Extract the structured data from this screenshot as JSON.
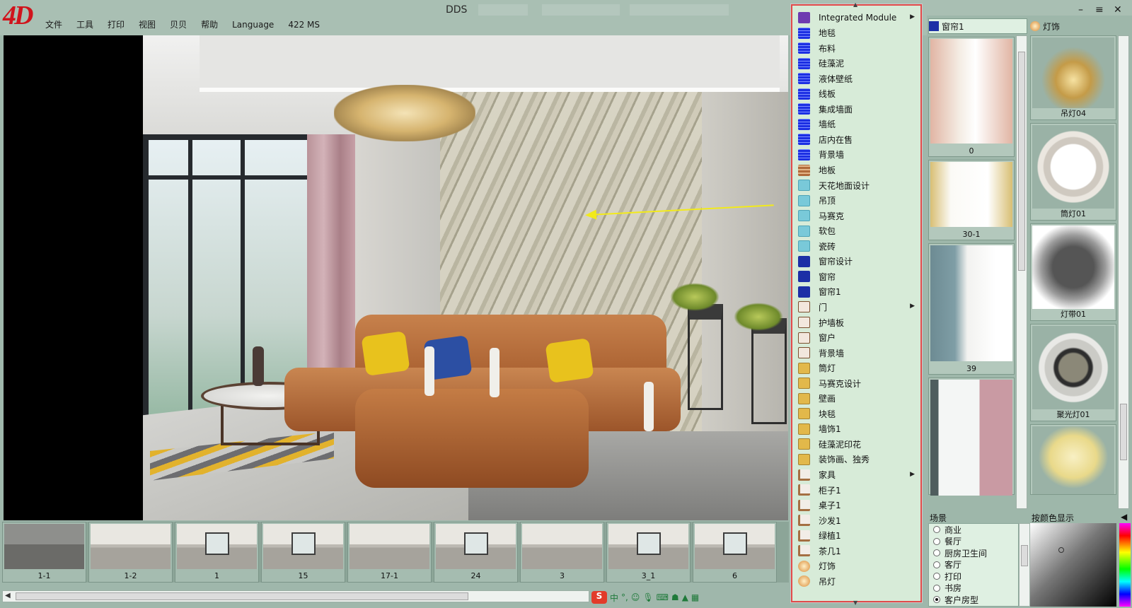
{
  "app": {
    "logo": "4D",
    "title": "DDS",
    "menu": [
      "文件",
      "工具",
      "打印",
      "视图",
      "贝贝",
      "帮助",
      "Language",
      "422 MS"
    ],
    "window_controls": {
      "minimize": "–",
      "maximize": "≡",
      "close": "✕"
    }
  },
  "thumbnails": [
    {
      "label": "1-1"
    },
    {
      "label": "1-2"
    },
    {
      "label": "1"
    },
    {
      "label": "15"
    },
    {
      "label": "17-1"
    },
    {
      "label": "24"
    },
    {
      "label": "3"
    },
    {
      "label": "3_1"
    },
    {
      "label": "6"
    }
  ],
  "context_menu": {
    "items": [
      {
        "label": "Integrated Module",
        "icon": "integrated-icon",
        "submenu": true
      },
      {
        "label": "地毯",
        "icon": "grid-icon"
      },
      {
        "label": "布料",
        "icon": "grid-icon"
      },
      {
        "label": "硅藻泥",
        "icon": "grid-icon"
      },
      {
        "label": "液体壁纸",
        "icon": "grid-icon"
      },
      {
        "label": "线板",
        "icon": "grid-icon"
      },
      {
        "label": "集成墙面",
        "icon": "grid-icon"
      },
      {
        "label": "墙纸",
        "icon": "grid-icon"
      },
      {
        "label": "店内在售",
        "icon": "grid-icon"
      },
      {
        "label": "背景墙",
        "icon": "grid-icon"
      },
      {
        "label": "地板",
        "icon": "wood-icon"
      },
      {
        "label": "天花地面设计",
        "icon": "tile-icon"
      },
      {
        "label": "吊顶",
        "icon": "tile-icon"
      },
      {
        "label": "马赛克",
        "icon": "tile-icon"
      },
      {
        "label": "软包",
        "icon": "tile-icon"
      },
      {
        "label": "瓷砖",
        "icon": "tile-icon"
      },
      {
        "label": "窗帘设计",
        "icon": "curtain-icon"
      },
      {
        "label": "窗帘",
        "icon": "curtain-icon"
      },
      {
        "label": "窗帘1",
        "icon": "curtain-icon"
      },
      {
        "label": "门",
        "icon": "door-icon",
        "submenu": true
      },
      {
        "label": "护墙板",
        "icon": "door-icon"
      },
      {
        "label": "窗户",
        "icon": "door-icon"
      },
      {
        "label": "背景墙",
        "icon": "door-icon"
      },
      {
        "label": "筒灯",
        "icon": "decor-icon"
      },
      {
        "label": "马赛克设计",
        "icon": "decor-icon"
      },
      {
        "label": "壁画",
        "icon": "decor-icon"
      },
      {
        "label": "块毯",
        "icon": "decor-icon"
      },
      {
        "label": "墙饰1",
        "icon": "decor-icon"
      },
      {
        "label": "硅藻泥印花",
        "icon": "decor-icon"
      },
      {
        "label": "装饰画、独秀",
        "icon": "decor-icon"
      },
      {
        "label": "家具",
        "icon": "furniture-icon",
        "submenu": true
      },
      {
        "label": "柜子1",
        "icon": "furniture-icon"
      },
      {
        "label": "桌子1",
        "icon": "furniture-icon"
      },
      {
        "label": "沙发1",
        "icon": "furniture-icon"
      },
      {
        "label": "绿植1",
        "icon": "furniture-icon"
      },
      {
        "label": "茶几1",
        "icon": "furniture-icon"
      },
      {
        "label": "灯饰",
        "icon": "light-icon"
      },
      {
        "label": "吊灯",
        "icon": "light-icon"
      }
    ]
  },
  "right_panel": {
    "tabs": [
      {
        "label": "窗帘1",
        "active": true
      },
      {
        "label": "灯饰",
        "active": false
      }
    ],
    "curtains": [
      {
        "label": "0"
      },
      {
        "label": "30-1"
      },
      {
        "label": "39"
      },
      {
        "label": ""
      }
    ],
    "lights": [
      {
        "label": "吊灯04"
      },
      {
        "label": "筒灯01"
      },
      {
        "label": "灯带01"
      },
      {
        "label": "聚光灯01"
      },
      {
        "label": ""
      }
    ],
    "scene_label": "场景",
    "color_label": "按颜色显示",
    "scene_options": [
      {
        "label": "商业",
        "selected": false
      },
      {
        "label": "餐厅",
        "selected": false
      },
      {
        "label": "厨房卫生间",
        "selected": false
      },
      {
        "label": "客厅",
        "selected": false
      },
      {
        "label": "打印",
        "selected": false
      },
      {
        "label": "书房",
        "selected": false
      },
      {
        "label": "客户房型",
        "selected": true
      }
    ]
  },
  "tray": {
    "ime": "S",
    "lang": "中"
  },
  "colors": {
    "menu_highlight_border": "#e24a4a",
    "menu_bg": "#d7ebd8",
    "panel_bg": "#9eb7aa",
    "arrow": "#f2ea1a"
  }
}
